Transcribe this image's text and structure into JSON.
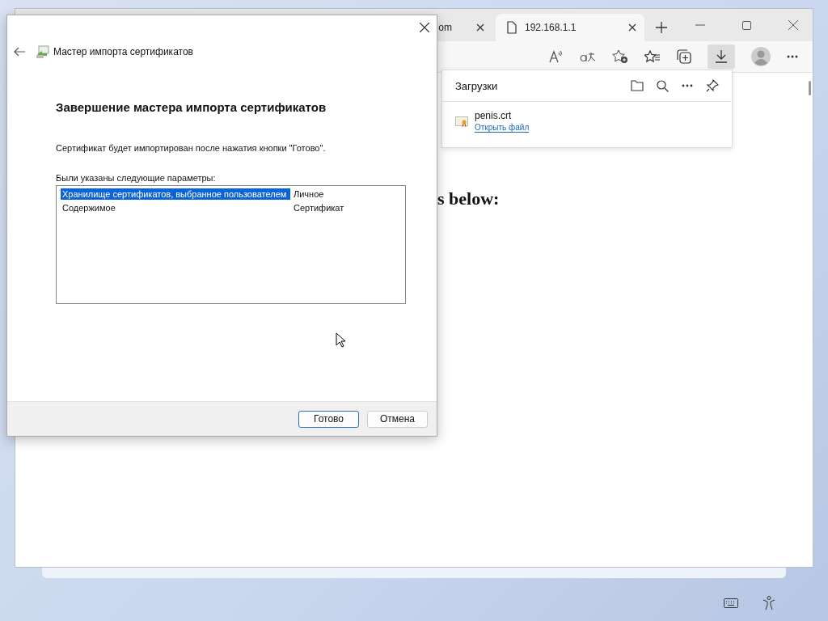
{
  "browser": {
    "tabs": [
      {
        "title": "om",
        "selected": false
      },
      {
        "title": "192.168.1.1",
        "selected": true
      }
    ],
    "page_text": "s below:",
    "downloads": {
      "title": "Загрузки",
      "items": [
        {
          "name": "penis.crt",
          "action": "Открыть файл"
        }
      ]
    }
  },
  "wizard": {
    "title": "Мастер импорта сертификатов",
    "heading": "Завершение мастера импорта сертификатов",
    "message": "Сертификат будет импортирован после нажатия кнопки \"Готово\".",
    "list_label": "Были указаны следующие параметры:",
    "rows": [
      {
        "name": "Хранилище сертификатов, выбранное пользователем",
        "value": "Личное",
        "selected": true
      },
      {
        "name": "Содержимое",
        "value": "Сертификат",
        "selected": false
      }
    ],
    "buttons": [
      {
        "label": "Готово",
        "kind": "primary"
      },
      {
        "label": "Отмена",
        "kind": "normal"
      }
    ]
  }
}
